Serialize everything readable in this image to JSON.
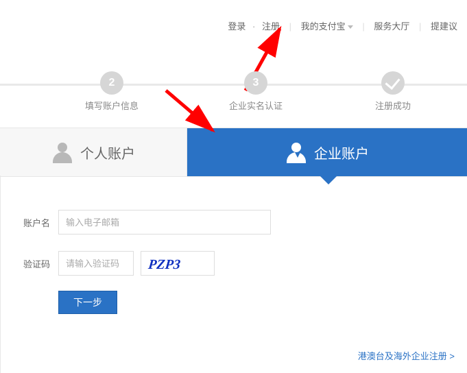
{
  "topnav": {
    "login": "登录",
    "register": "注册",
    "myalipay": "我的支付宝",
    "servicehall": "服务大厅",
    "suggest": "提建议"
  },
  "steps": {
    "s1": {
      "num": "2",
      "label": "填写账户信息"
    },
    "s2": {
      "num": "3",
      "label": "企业实名认证"
    },
    "s3": {
      "label": "注册成功"
    }
  },
  "tabs": {
    "personal": "个人账户",
    "company": "企业账户"
  },
  "form": {
    "account_label": "账户名",
    "account_placeholder": "输入电子邮箱",
    "captcha_label": "验证码",
    "captcha_placeholder": "请输入验证码",
    "captcha_text": "PZP3",
    "next_label": "下一步"
  },
  "links": {
    "overseas": "港澳台及海外企业注册 >"
  }
}
